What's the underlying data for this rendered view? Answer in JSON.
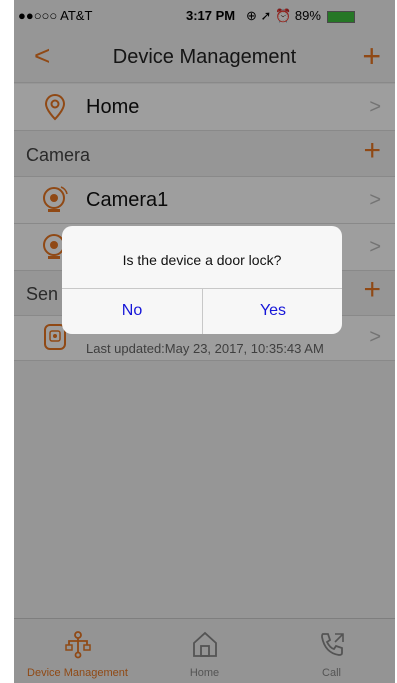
{
  "status_bar": {
    "carrier": "●●○○○ AT&T",
    "time": "3:17 PM",
    "battery": "89%"
  },
  "nav": {
    "title": "Device Management",
    "back_icon": "chevron-left-icon",
    "add_icon": "plus-icon"
  },
  "home_row": {
    "label": "Home"
  },
  "camera_section": {
    "title": "Camera"
  },
  "cameras": [
    {
      "label": "Camera1"
    },
    {
      "label": ""
    }
  ],
  "sensor_section": {
    "title": "Sen"
  },
  "sensor_row": {
    "label": "",
    "updated": "Last updated:May 23, 2017, 10:35:43 AM"
  },
  "dialog": {
    "message": "Is the device a door lock?",
    "no_label": "No",
    "yes_label": "Yes"
  },
  "tabs": [
    {
      "label": "Device Management",
      "active": true
    },
    {
      "label": "Home",
      "active": false
    },
    {
      "label": "Call",
      "active": false
    }
  ],
  "colors": {
    "accent": "#e87722",
    "dialog_button": "#1616d8"
  }
}
